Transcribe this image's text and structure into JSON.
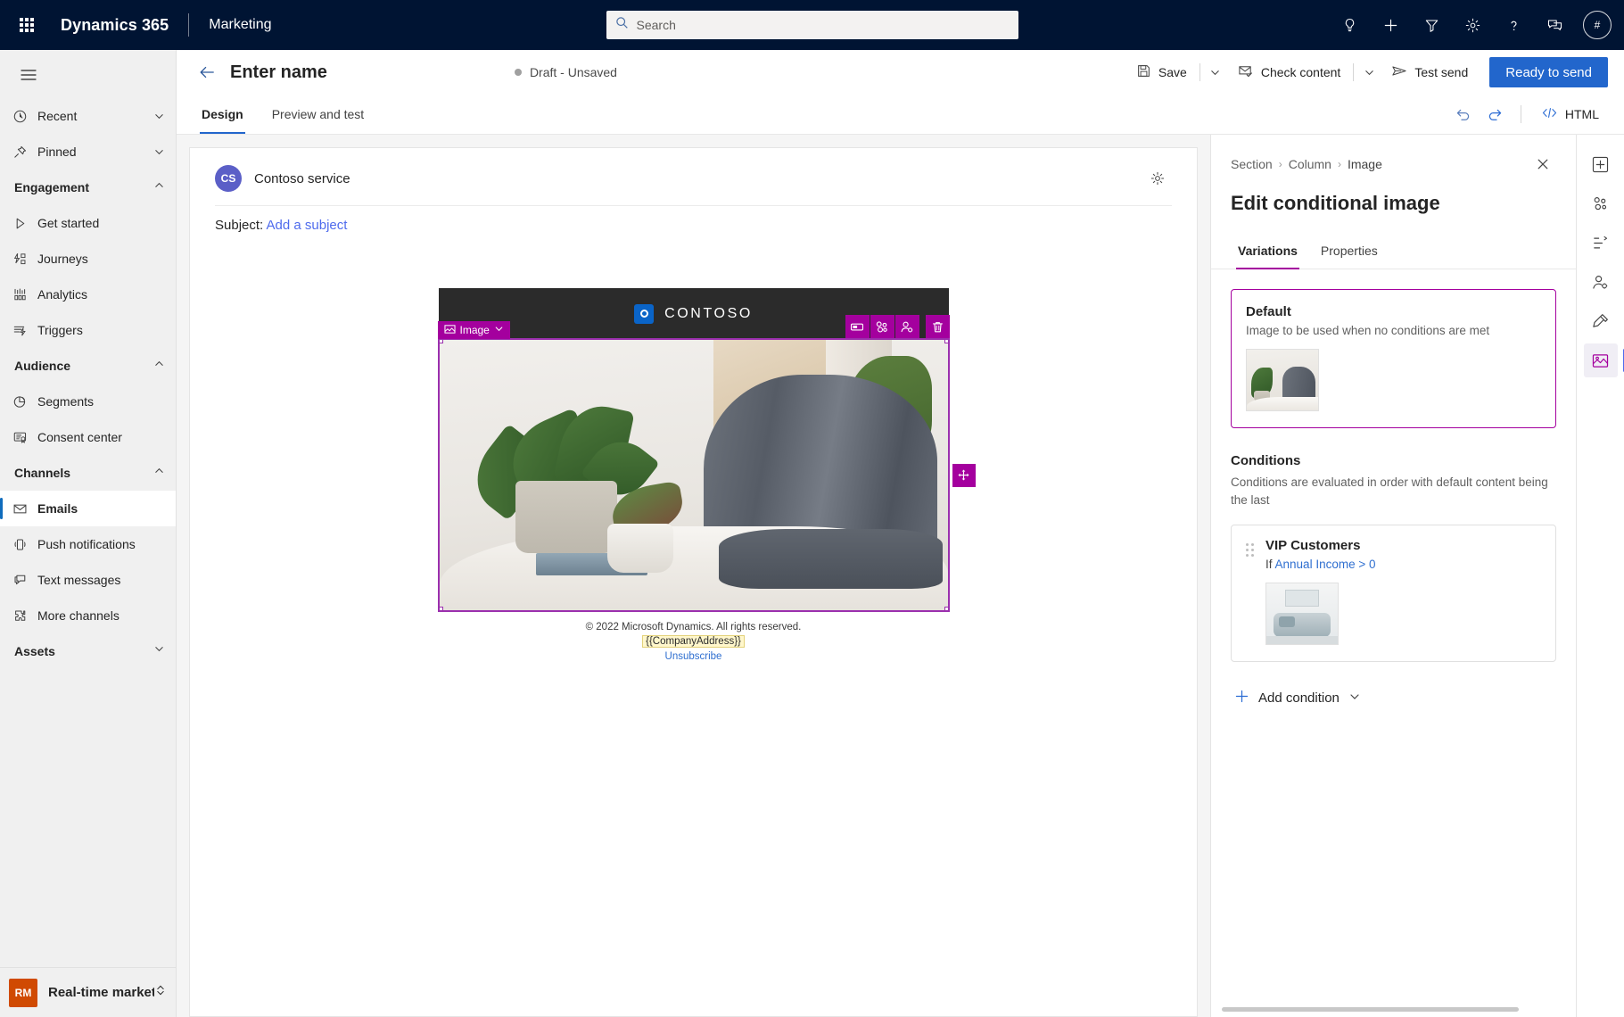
{
  "topbar": {
    "waffle_label": "app-launcher",
    "brand": "Dynamics 365",
    "app_name": "Marketing",
    "search_placeholder": "Search",
    "icons": [
      {
        "name": "lightbulb-icon",
        "label": "Insights"
      },
      {
        "name": "plus-icon",
        "label": "New"
      },
      {
        "name": "filter-icon",
        "label": "Filter"
      },
      {
        "name": "gear-icon",
        "label": "Settings"
      },
      {
        "name": "help-icon",
        "label": "Help"
      },
      {
        "name": "feedback-icon",
        "label": "Feedback"
      }
    ],
    "avatar_text": "#"
  },
  "sidebar": {
    "hamburger_label": "Show/Hide navigation",
    "items": [
      {
        "label": "Recent",
        "icon": "clock-icon",
        "type": "expandable",
        "expanded": false
      },
      {
        "label": "Pinned",
        "icon": "pin-icon",
        "type": "expandable",
        "expanded": false
      },
      {
        "label": "Engagement",
        "type": "group",
        "expanded": true
      },
      {
        "label": "Get started",
        "icon": "play-icon",
        "type": "item"
      },
      {
        "label": "Journeys",
        "icon": "journeys-icon",
        "type": "item"
      },
      {
        "label": "Analytics",
        "icon": "analytics-icon",
        "type": "item"
      },
      {
        "label": "Triggers",
        "icon": "triggers-icon",
        "type": "item"
      },
      {
        "label": "Audience",
        "type": "group",
        "expanded": true
      },
      {
        "label": "Segments",
        "icon": "segments-icon",
        "type": "item"
      },
      {
        "label": "Consent center",
        "icon": "consent-icon",
        "type": "item"
      },
      {
        "label": "Channels",
        "type": "group",
        "expanded": true
      },
      {
        "label": "Emails",
        "icon": "mail-icon",
        "type": "item",
        "selected": true
      },
      {
        "label": "Push notifications",
        "icon": "phone-icon",
        "type": "item"
      },
      {
        "label": "Text messages",
        "icon": "chat-icon",
        "type": "item"
      },
      {
        "label": "More channels",
        "icon": "puzzle-icon",
        "type": "item"
      },
      {
        "label": "Assets",
        "type": "group",
        "expanded": false
      }
    ],
    "footer": {
      "badge": "RM",
      "label": "Real-time marketi...",
      "badge_color": "#d04a02"
    }
  },
  "command_bar": {
    "back_label": "Back",
    "record_title": "Enter name",
    "status": "Draft - Unsaved",
    "save_label": "Save",
    "check_content_label": "Check content",
    "test_send_label": "Test send",
    "ready_to_send_label": "Ready to send",
    "primary_color": "#2266cc"
  },
  "tabs": {
    "items": [
      {
        "label": "Design",
        "active": true
      },
      {
        "label": "Preview and test",
        "active": false
      }
    ],
    "undo_label": "Undo",
    "redo_label": "Redo",
    "html_label": "HTML"
  },
  "email": {
    "sender_initials": "CS",
    "sender_name": "Contoso service",
    "settings_label": "Email settings",
    "subject_label": "Subject:",
    "subject_link": "Add a subject",
    "brand_word": "CONTOSO",
    "block_tag": "Image",
    "toolbar_buttons": [
      {
        "name": "layout-icon",
        "label": "Change layout"
      },
      {
        "name": "conditional-content-icon",
        "label": "Conditional content"
      },
      {
        "name": "personalization-icon",
        "label": "Personalization"
      },
      {
        "name": "delete-icon",
        "label": "Delete"
      }
    ],
    "move_handle_label": "Move block",
    "footer_copyright": "© 2022 Microsoft Dynamics. All rights reserved.",
    "footer_token": "{{CompanyAddress}}",
    "footer_unsubscribe": "Unsubscribe"
  },
  "right_panel": {
    "breadcrumb": [
      "Section",
      "Column",
      "Image"
    ],
    "close_label": "Close",
    "title": "Edit conditional image",
    "tabs": [
      {
        "label": "Variations",
        "active": true
      },
      {
        "label": "Properties",
        "active": false
      }
    ],
    "default_card": {
      "title": "Default",
      "description": "Image to be used when no conditions are met"
    },
    "conditions": {
      "title": "Conditions",
      "description": "Conditions are evaluated in order with default content being the last",
      "items": [
        {
          "name": "VIP Customers",
          "rule_prefix": "If",
          "rule_field": "Annual Income",
          "rule_operator": ">",
          "rule_value": "0"
        }
      ]
    },
    "add_condition_label": "Add condition",
    "accent_color": "#a4009e"
  },
  "right_rail": [
    {
      "name": "add-element-icon",
      "label": "Elements",
      "active": false
    },
    {
      "name": "layouts-icon",
      "label": "Layouts",
      "active": false
    },
    {
      "name": "list-icon",
      "label": "Outline",
      "active": false
    },
    {
      "name": "personalization-rail-icon",
      "label": "Personalization",
      "active": false
    },
    {
      "name": "brand-icon",
      "label": "Brand",
      "active": false
    },
    {
      "name": "image-rail-icon",
      "label": "Image",
      "active": true
    }
  ]
}
